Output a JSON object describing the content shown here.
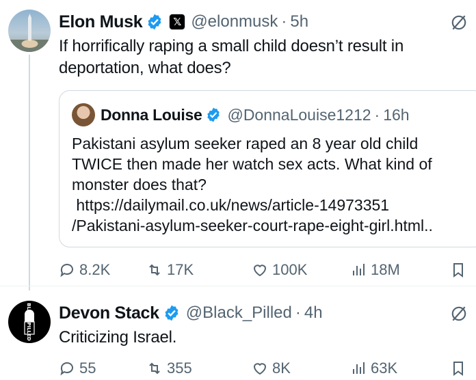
{
  "tweets": [
    {
      "author": {
        "name": "Elon Musk",
        "handle": "@elonmusk",
        "sep": "·",
        "time": "5h"
      },
      "text": "If horrifically raping a small child doesn’t result in deportation, what does?",
      "quote": {
        "author": {
          "name": "Donna Louise",
          "handle": "@DonnaLouise1212",
          "sep": "·",
          "time": "16h"
        },
        "text": "Pakistani asylum seeker raped an 8 year old child\nTWICE then made her watch sex acts. What kind of\nmonster does that?\n https://dailymail.co.uk/news/article-14973351\n/Pakistani-asylum-seeker-court-rape-eight-girl.html.."
      },
      "stats": {
        "replies": "8.2K",
        "retweets": "17K",
        "likes": "100K",
        "views": "18M"
      }
    },
    {
      "author": {
        "name": "Devon Stack",
        "handle": "@Black_Pilled",
        "sep": "·",
        "time": "4h"
      },
      "avatar_text": "BLACK PILLED",
      "text": "Criticizing Israel.",
      "stats": {
        "replies": "55",
        "retweets": "355",
        "likes": "8K",
        "views": "63K"
      }
    }
  ],
  "colors": {
    "verified": "#1d9bf0",
    "muted": "#536471",
    "text": "#0f1419",
    "border": "#cfd9de"
  },
  "icons": [
    "verified-badge-icon",
    "x-logo-icon",
    "grok-icon",
    "reply-icon",
    "retweet-icon",
    "like-icon",
    "views-icon",
    "bookmark-icon"
  ]
}
